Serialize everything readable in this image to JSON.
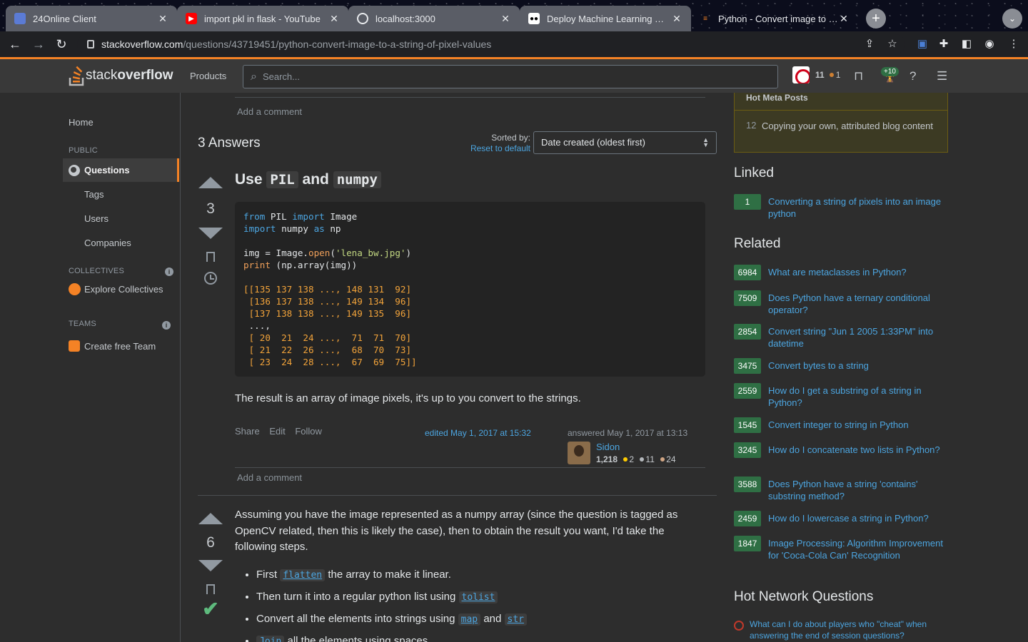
{
  "browser": {
    "tabs": [
      {
        "title": "24Online Client",
        "favicon": "24online-favicon"
      },
      {
        "title": "import pkl in flask - YouTube",
        "favicon": "youtube-favicon"
      },
      {
        "title": "localhost:3000",
        "favicon": "globe-favicon"
      },
      {
        "title": "Deploy Machine Learning Mod",
        "favicon": "medium-favicon"
      },
      {
        "title": "Python - Convert image to a st",
        "favicon": "stackoverflow-favicon"
      }
    ],
    "url_host": "stackoverflow.com",
    "url_path": "/questions/43719451/python-convert-image-to-a-string-of-pixel-values"
  },
  "header": {
    "logo_light": "stack",
    "logo_bold": "overflow",
    "products": "Products",
    "search_placeholder": "Search...",
    "rep": "11",
    "bronze": "1",
    "achievements_badge": "+10"
  },
  "leftnav": {
    "home": "Home",
    "public": "PUBLIC",
    "questions": "Questions",
    "tags": "Tags",
    "users": "Users",
    "companies": "Companies",
    "collectives": "COLLECTIVES",
    "explore_collectives": "Explore Collectives",
    "teams": "TEAMS",
    "create_team": "Create free Team"
  },
  "main": {
    "add_comment": "Add a comment",
    "answers_count": "3 Answers",
    "sorted_by": "Sorted by:",
    "reset_default": "Reset to default",
    "sort_value": "Date created (oldest first)",
    "answer1": {
      "votes": "3",
      "title_use": "Use",
      "title_pil": "PIL",
      "title_and": "and",
      "title_numpy": "numpy",
      "result_text": "The result is an array of image pixels, it's up to you convert to the strings.",
      "share": "Share",
      "edit": "Edit",
      "follow": "Follow",
      "edited": "edited May 1, 2017 at 15:32",
      "answered": "answered May 1, 2017 at 13:13",
      "user_name": "Sidon",
      "user_rep": "1,218",
      "gold": "2",
      "silver": "11",
      "bronze": "24"
    },
    "answer2": {
      "votes": "6",
      "intro": "Assuming you have the image represented as a numpy array (since the question is tagged as OpenCV related, then this is likely the case), then to obtain the result you want, I'd take the following steps.",
      "step1_pre": "First",
      "step1_code": "flatten",
      "step1_post": "the array to make it linear.",
      "step2_pre": "Then turn it into a regular python list using",
      "step2_code": "tolist",
      "step3_pre": "Convert all the elements into strings using",
      "step3_code1": "map",
      "step3_mid": "and",
      "step3_code2": "str",
      "step4_code": "Join",
      "step4_post": "all the elements using spaces."
    }
  },
  "code_lines": {
    "l1_from": "from",
    "l1_mod": " PIL ",
    "l1_import": "import",
    "l1_name": " Image",
    "l2_import": "import",
    "l2_mod": " numpy ",
    "l2_as": "as",
    "l2_name": " np",
    "l4_pre": "img = Image.",
    "l4_fn": "open",
    "l4_paren": "(",
    "l4_str": "'lena_bw.jpg'",
    "l4_close": ")",
    "l5_print": "print",
    "l5_rest": " (np.array(img))",
    "r1": "[[135 137 138 ..., 148 131  92]",
    "r2": " [136 137 138 ..., 149 134  96]",
    "r3": " [137 138 138 ..., 149 135  96]",
    "r4": " ...,",
    "r5": " [ 20  21  24 ...,  71  71  70]",
    "r6": " [ 21  22  26 ...,  68  70  73]",
    "r7": " [ 23  24  28 ...,  67  69  75]]"
  },
  "right": {
    "hot_meta": "Hot Meta Posts",
    "meta_num": "12",
    "meta_text": "Copying your own, attributed blog content",
    "linked": "Linked",
    "linked_items": [
      {
        "score": "1",
        "title": "Converting a string of pixels into an image python"
      }
    ],
    "related": "Related",
    "related_items": [
      {
        "score": "6984",
        "title": "What are metaclasses in Python?"
      },
      {
        "score": "7509",
        "title": "Does Python have a ternary conditional operator?"
      },
      {
        "score": "2854",
        "title": "Convert string \"Jun 1 2005 1:33PM\" into datetime"
      },
      {
        "score": "3475",
        "title": "Convert bytes to a string"
      },
      {
        "score": "2559",
        "title": "How do I get a substring of a string in Python?"
      },
      {
        "score": "1545",
        "title": "Convert integer to string in Python"
      },
      {
        "score": "3245",
        "title": "How do I concatenate two lists in Python?"
      },
      {
        "score": "3588",
        "title": "Does Python have a string 'contains' substring method?"
      },
      {
        "score": "2459",
        "title": "How do I lowercase a string in Python?"
      },
      {
        "score": "1847",
        "title": "Image Processing: Algorithm Improvement for 'Coca-Cola Can' Recognition"
      }
    ],
    "hot_network": "Hot Network Questions",
    "hnq_item": "What can I do about players who \"cheat\" when answering the end of session questions?"
  },
  "colors": {
    "accent": "#f48225",
    "link": "#4ca5e0",
    "score_green": "#2f6f44"
  }
}
